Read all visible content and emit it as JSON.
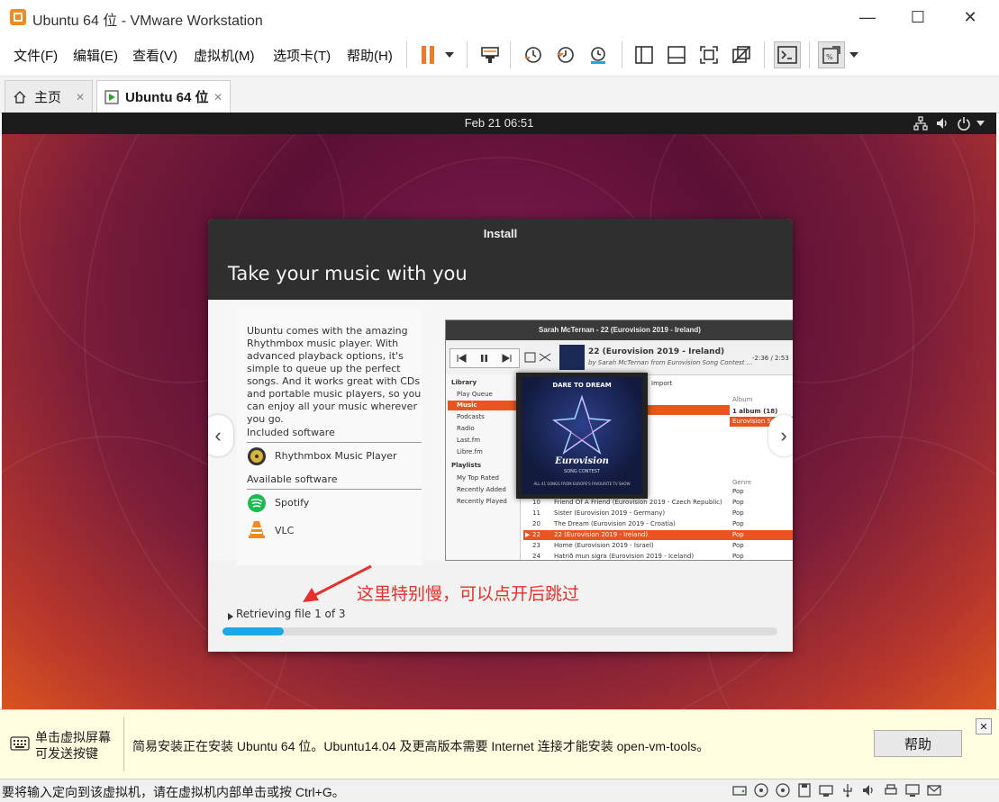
{
  "window": {
    "title": "Ubuntu 64 位 - VMware Workstation",
    "controls": [
      "—",
      "☐",
      "✕"
    ]
  },
  "menu": {
    "items": [
      "文件(F)",
      "编辑(E)",
      "查看(V)",
      "虚拟机(M)",
      "选项卡(T)",
      "帮助(H)"
    ]
  },
  "tabs": [
    {
      "label": "主页",
      "close": "✕"
    },
    {
      "label": "Ubuntu 64 位",
      "close": "✕"
    }
  ],
  "gnome": {
    "clock": "Feb 21  06:51"
  },
  "installer": {
    "window_title": "Install",
    "heading": "Take your music with you",
    "description": "Ubuntu comes with the amazing Rhythmbox music player. With advanced playback options, it's simple to queue up the perfect songs. And it works great with CDs and portable music players, so you can enjoy all your music wherever you go.",
    "included_label": "Included software",
    "included": [
      {
        "name": "Rhythmbox Music Player",
        "icon": "rhythmbox-icon"
      }
    ],
    "available_label": "Available software",
    "available": [
      {
        "name": "Spotify",
        "icon": "spotify-icon"
      },
      {
        "name": "VLC",
        "icon": "vlc-icon"
      }
    ],
    "nav_prev": "‹",
    "nav_next": "›",
    "status": "Retrieving file 1 of 3",
    "progress": 0.11,
    "rhythmbox": {
      "title": "Sarah McTernan - 22 (Eurovision 2019 - Ireland)",
      "track": "22 (Eurovision 2019 - Ireland)",
      "by": "by Sarah McTernan from Eurovision Song Contest ...",
      "time": "-2:36 / 2:53",
      "import": "Import",
      "sidebar_library": "Library",
      "sidebar_items": [
        "Play Queue",
        "Music",
        "Podcasts",
        "Radio",
        "Last.fm",
        "Libre.fm"
      ],
      "sidebar_playlists": "Playlists",
      "playlist_items": [
        "My Top Rated",
        "Recently Added",
        "Recently Played"
      ],
      "album_header": "Album",
      "album_items": [
        "1 album (18)",
        "Eurovision Song"
      ],
      "genre_header": "Genre",
      "album_art": {
        "top": "DARE TO DREAM",
        "logo": "Eurovision",
        "sub": "SONG CONTEST",
        "caption": "ALL 41 SONGS FROM EUROPE'S FAVOURITE TV SHOW"
      },
      "rows": [
        {
          "num": "",
          "title": "...prus)",
          "genre": "Pop"
        },
        {
          "num": "10",
          "title": "Friend Of A Friend (Eurovision 2019 - Czech Republic)",
          "genre": "Pop"
        },
        {
          "num": "11",
          "title": "Sister (Eurovision 2019 - Germany)",
          "genre": "Pop"
        },
        {
          "num": "20",
          "title": "The Dream (Eurovision 2019 - Croatia)",
          "genre": "Pop"
        },
        {
          "num": "22",
          "title": "22 (Eurovision 2019 - Ireland)",
          "genre": "Pop",
          "playing": true
        },
        {
          "num": "23",
          "title": "Home (Eurovision 2019 - Israel)",
          "genre": "Pop"
        },
        {
          "num": "24",
          "title": "Hatrið mun sigra (Eurovision 2019 - Iceland)",
          "genre": "Pop"
        }
      ]
    }
  },
  "annotation": {
    "text": "这里特别慢，可以点开后跳过",
    "color": "#e8302a"
  },
  "notice": {
    "left_line1": "单击虚拟屏幕",
    "left_line2": "可发送按键",
    "message": "简易安装正在安装 Ubuntu 64 位。Ubuntu14.04 及更高版本需要 Internet 连接才能安装 open-vm-tools。",
    "help_button": "帮助",
    "close": "✕"
  },
  "statusbar": {
    "text": "要将输入定向到该虚拟机，请在虚拟机内部单击或按 Ctrl+G。"
  },
  "colors": {
    "accent_orange": "#e95420",
    "pause_orange": "#f07a2a",
    "progress_blue": "#1ea7e6"
  }
}
